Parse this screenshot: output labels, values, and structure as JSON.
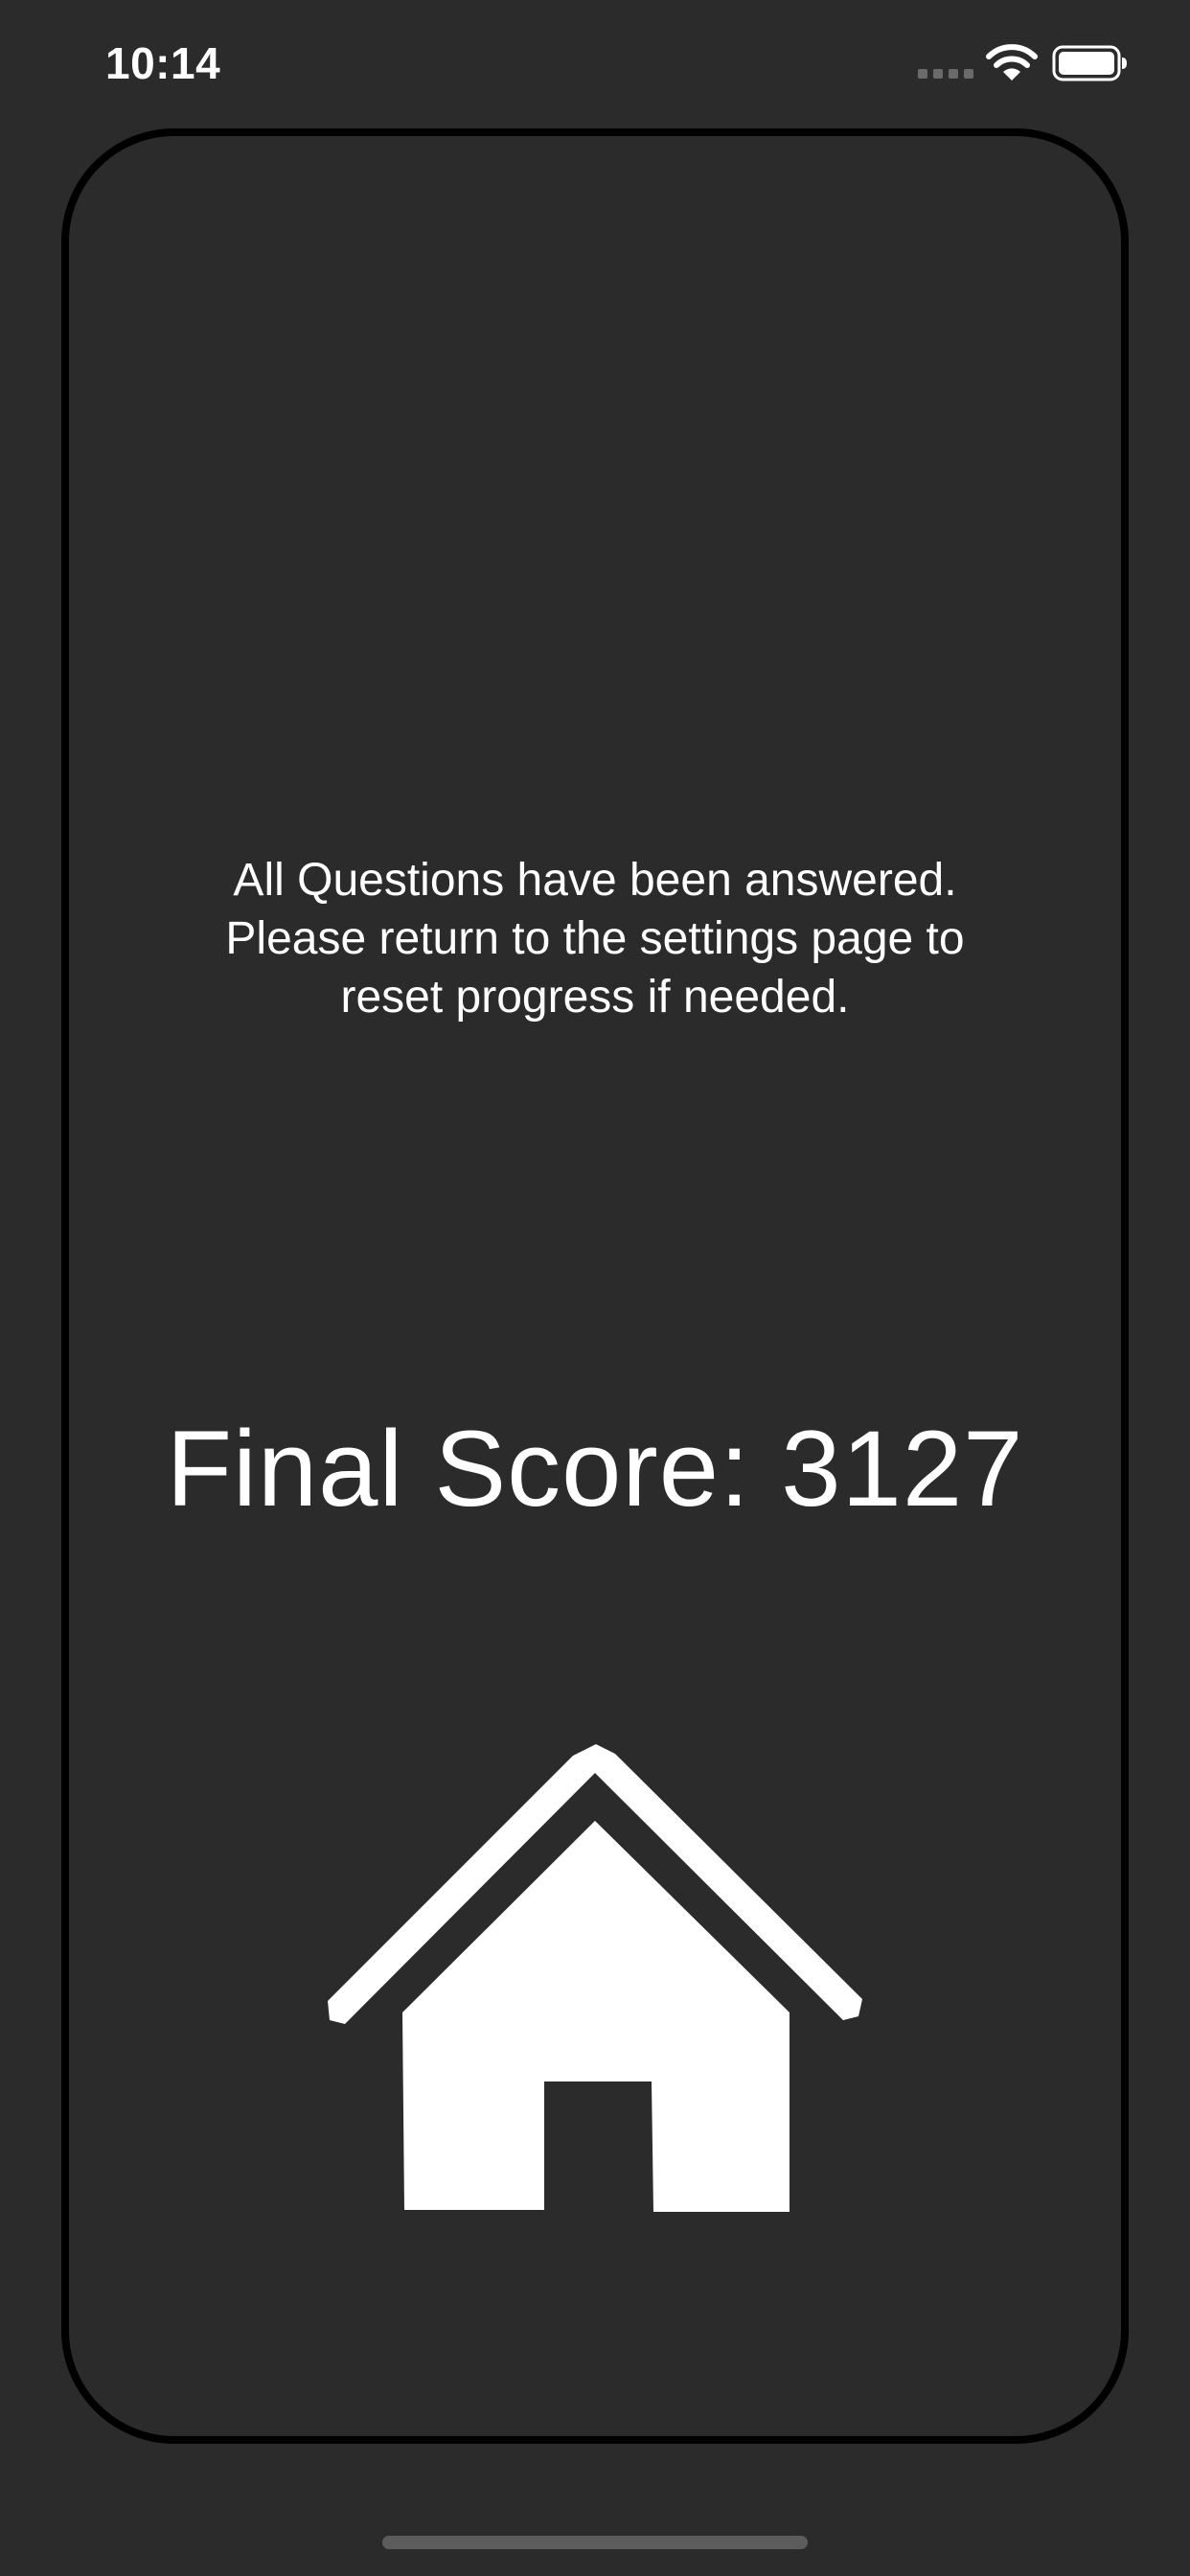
{
  "status_bar": {
    "time": "10:14",
    "icons": [
      "signal-dots-icon",
      "wifi-icon",
      "battery-icon"
    ]
  },
  "message": "All Questions have been answered.\nPlease return to the settings page to\nreset progress if needed.",
  "score": {
    "label": "Final Score:",
    "value": "3127"
  },
  "home_button": {
    "icon": "home-icon"
  },
  "colors": {
    "background": "#2b2b2b",
    "card_border": "#000000",
    "text": "#ffffff",
    "home_indicator": "#5c5c5c"
  }
}
